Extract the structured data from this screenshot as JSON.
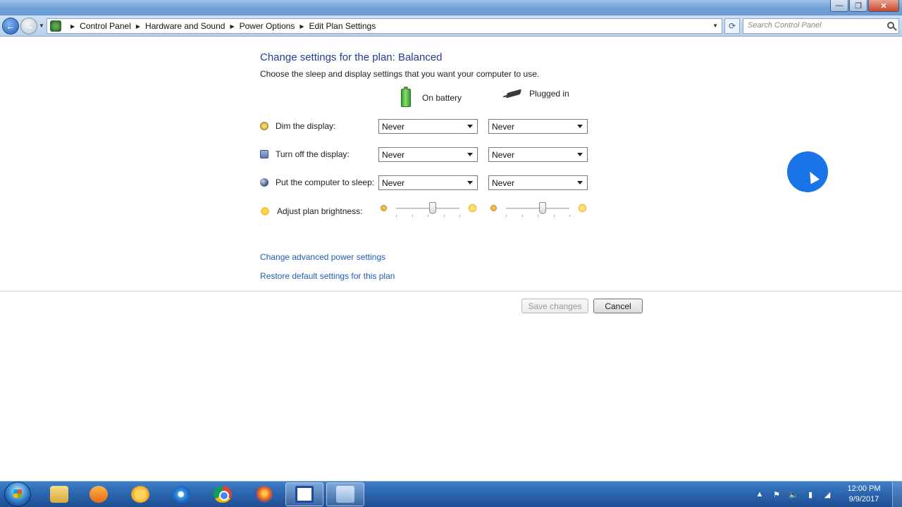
{
  "window": {
    "controls": {
      "minimize": "—",
      "maximize": "❐",
      "close": "✕"
    }
  },
  "address": {
    "crumbs": [
      "Control Panel",
      "Hardware and Sound",
      "Power Options",
      "Edit Plan Settings"
    ],
    "search_placeholder": "Search Control Panel"
  },
  "plan": {
    "title": "Change settings for the plan: Balanced",
    "description": "Choose the sleep and display settings that you want your computer to use.",
    "columns": {
      "battery": "On battery",
      "plugged": "Plugged in"
    },
    "rows": [
      {
        "label": "Dim the display:",
        "battery": "Never",
        "plugged": "Never"
      },
      {
        "label": "Turn off the display:",
        "battery": "Never",
        "plugged": "Never"
      },
      {
        "label": "Put the computer to sleep:",
        "battery": "Never",
        "plugged": "Never"
      }
    ],
    "brightness": {
      "label": "Adjust plan brightness:",
      "battery_level": 0.58,
      "plugged_level": 0.58
    },
    "links": {
      "advanced": "Change advanced power settings",
      "restore": "Restore default settings for this plan"
    },
    "buttons": {
      "save": "Save changes",
      "cancel": "Cancel"
    }
  },
  "taskbar": {
    "clock_time": "12:00 PM",
    "clock_date": "9/9/2017"
  },
  "colors": {
    "title_blue": "#1e3f92",
    "link_blue": "#1f5db3",
    "taskbar": "#2a64ad",
    "cursor_halo": "#1a73e8"
  }
}
